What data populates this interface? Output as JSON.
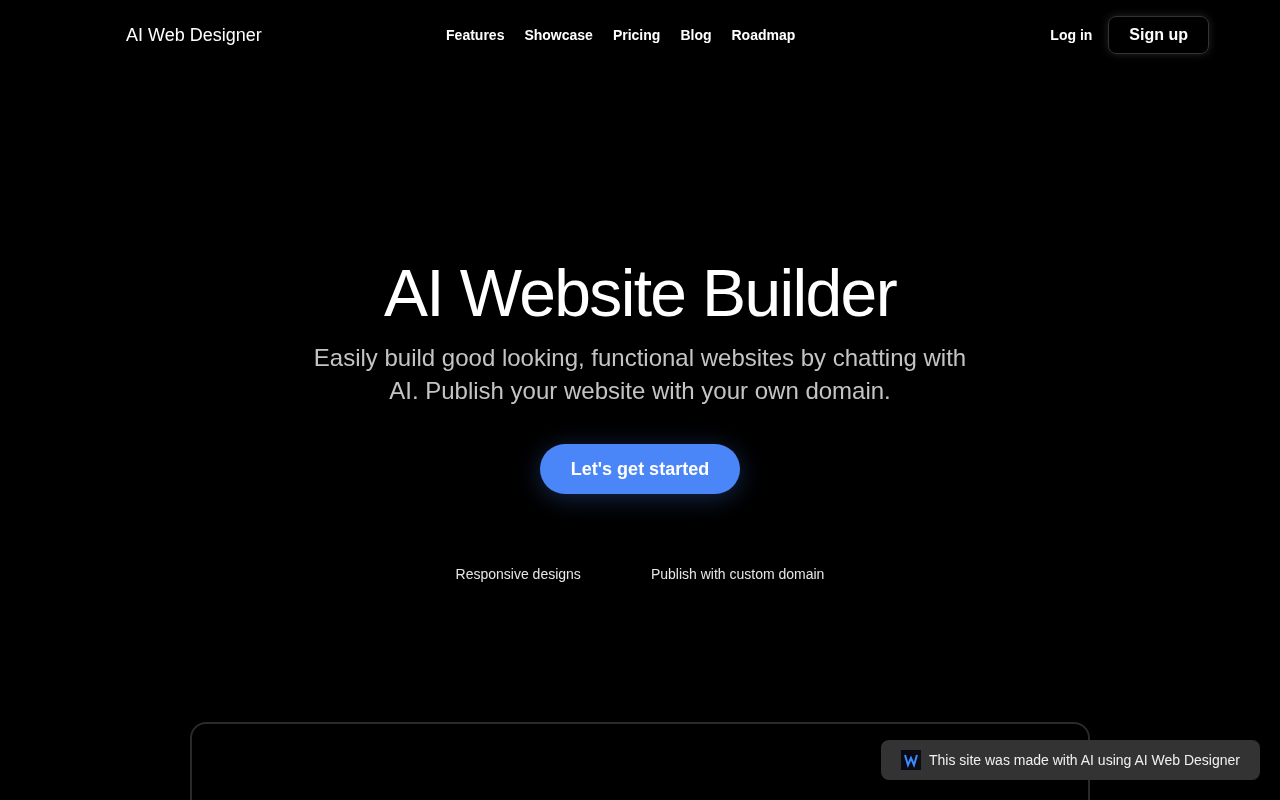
{
  "header": {
    "logo": "AI Web Designer",
    "nav": [
      {
        "label": "Features"
      },
      {
        "label": "Showcase"
      },
      {
        "label": "Pricing"
      },
      {
        "label": "Blog"
      },
      {
        "label": "Roadmap"
      }
    ],
    "login": "Log in",
    "signup": "Sign up"
  },
  "hero": {
    "title": "AI Website Builder",
    "subtitle": "Easily build good looking, functional websites by chatting with AI. Publish your website with your own domain.",
    "cta": "Let's get started",
    "features": [
      "Responsive designs",
      "Publish with custom domain"
    ]
  },
  "badge": {
    "text": "This site was made with AI using AI Web Designer"
  }
}
